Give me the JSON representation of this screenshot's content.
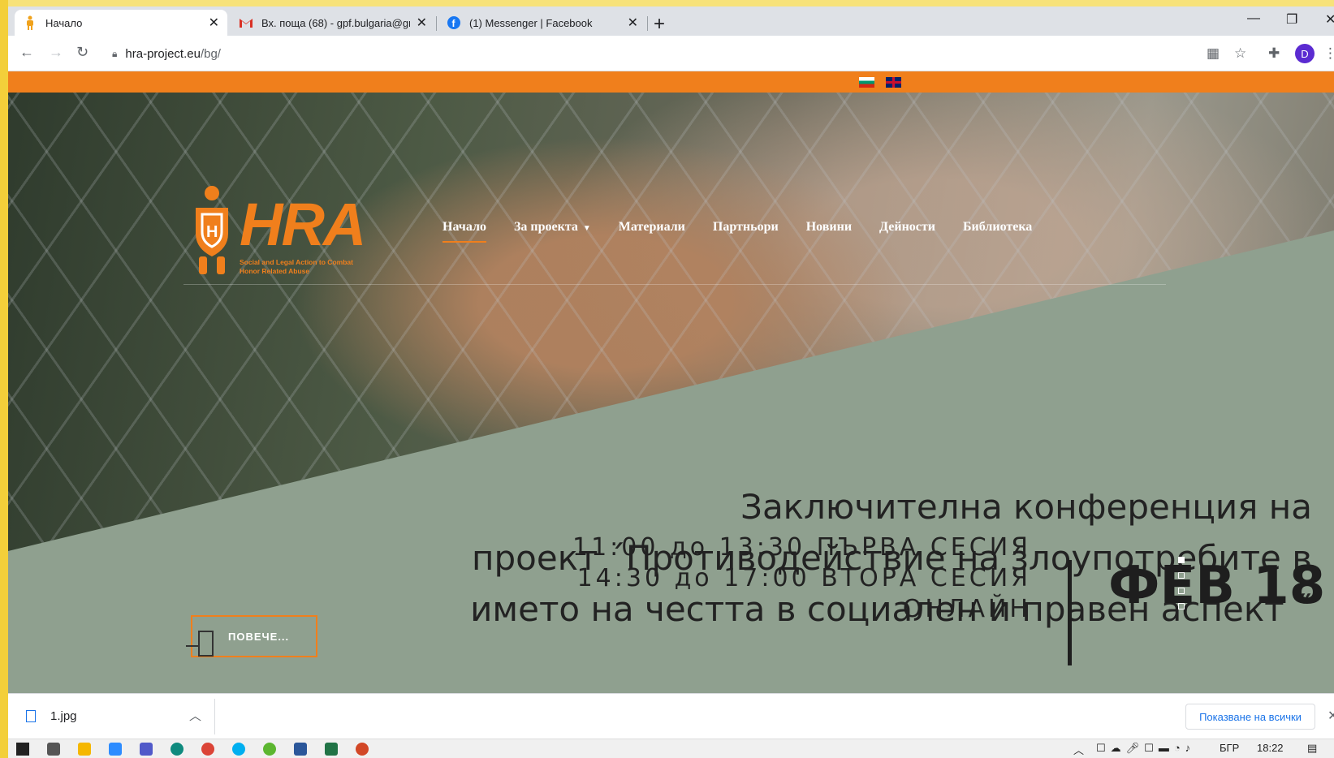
{
  "browser": {
    "tabs": [
      {
        "title": "Начало",
        "active": true,
        "icon": "hra-figure-icon"
      },
      {
        "title": "Вх. поща (68) - gpf.bulgaria@gm",
        "active": false,
        "icon": "gmail-icon"
      },
      {
        "title": "(1) Messenger | Facebook",
        "active": false,
        "icon": "facebook-icon"
      }
    ],
    "new_tab": "+",
    "close_glyph": "✕",
    "url_host": "hra-project.eu",
    "url_path": "/bg/",
    "profile_initial": "D"
  },
  "site": {
    "logo_text": "HRA",
    "logo_tagline_1": "Social and Legal Action to Combat",
    "logo_tagline_2": "Honor Related Abuse",
    "nav": [
      "Начало",
      "За проекта",
      "Материали",
      "Партньори",
      "Новини",
      "Дейности",
      "Библиотека"
    ],
    "headline_1": "Заключителна конференция на",
    "headline_2": "проект ´Противодействие на злоупотребите в",
    "headline_3": "името на честта в социален и правен аспект ˝",
    "session_1": "11:00 до 13:30 ПЪРВА СЕСИЯ",
    "session_2": "14:30 до 17:00 ВТОРА СЕСИЯ",
    "session_3": "ОНЛАЙН",
    "date": "ФЕВ 18",
    "more_button": "ПОВЕЧЕ...",
    "colors": {
      "accent": "#f07f1c",
      "panel": "#8fa08f"
    }
  },
  "downloads": {
    "file": "1.jpg",
    "show_all": "Показване на всички"
  },
  "taskbar": {
    "lang": "БГР",
    "time": "18:22"
  }
}
